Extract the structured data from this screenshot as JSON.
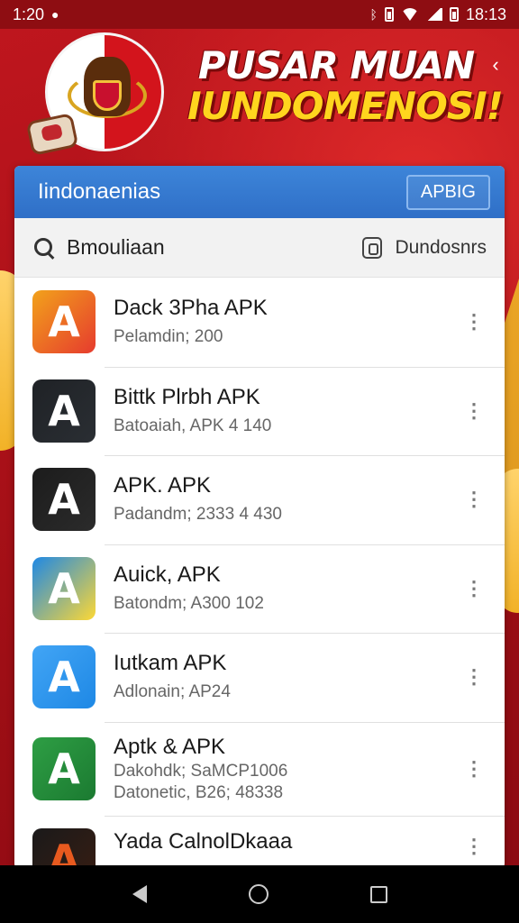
{
  "status_bar": {
    "time_left": "1:20",
    "time_right": "18:13"
  },
  "banner": {
    "headline_line1": "PUSAR MUAN",
    "headline_line2": "IUNDOMENOSI!",
    "share_icon": "share-icon"
  },
  "card": {
    "header_title": "Iindonaenias",
    "header_button": "APBIG",
    "search_label": "Bmouliaan",
    "download_label": "Dundosnrs"
  },
  "apps": [
    {
      "name": "Dack 3Pha APK",
      "sub": "Pelamdin; 200",
      "sub2": "",
      "icon_letter": "A",
      "icon_colors": [
        "#f2a21b",
        "#e63b2e"
      ],
      "icon_fg": "#ffffff"
    },
    {
      "name": "Bittk Plrbh APK",
      "sub": "Batoaiah, APK 4 140",
      "sub2": "",
      "icon_letter": "A",
      "icon_colors": [
        "#1f2226",
        "#2a2e33"
      ],
      "icon_fg": "#ffffff"
    },
    {
      "name": "APK. APK",
      "sub": "Padandm; 2333 4 430",
      "sub2": "",
      "icon_letter": "A",
      "icon_colors": [
        "#1c1c1c",
        "#2b2b2b"
      ],
      "icon_fg": "#ffffff"
    },
    {
      "name": "Auick, APK",
      "sub": "Batondm; A300     102",
      "sub2": "",
      "icon_letter": "A",
      "icon_colors": [
        "#1e88e5",
        "#fdd835"
      ],
      "icon_fg": "#ffffff"
    },
    {
      "name": "Iutkam APK",
      "sub": "Adlonain; AP24",
      "sub2": "",
      "icon_letter": "A",
      "icon_colors": [
        "#42a5f5",
        "#1e88e5"
      ],
      "icon_fg": "#ffffff"
    },
    {
      "name": "Aptk & APK",
      "sub": "Dakohdk; SaMCP1006",
      "sub2": "Datonetic, B26; 48338",
      "icon_letter": "A",
      "icon_colors": [
        "#2e9e44",
        "#1b7a31"
      ],
      "icon_fg": "#ffffff"
    },
    {
      "name": "Yada CalnolDkaaa",
      "sub": "",
      "sub2": "",
      "icon_letter": "A",
      "icon_colors": [
        "#1a1a1a",
        "#3a1d12"
      ],
      "icon_fg": "#e85a1f"
    }
  ],
  "nav": {
    "back_icon": "back-triangle-icon",
    "home_icon": "home-circle-icon",
    "recent_icon": "recents-square-icon"
  }
}
